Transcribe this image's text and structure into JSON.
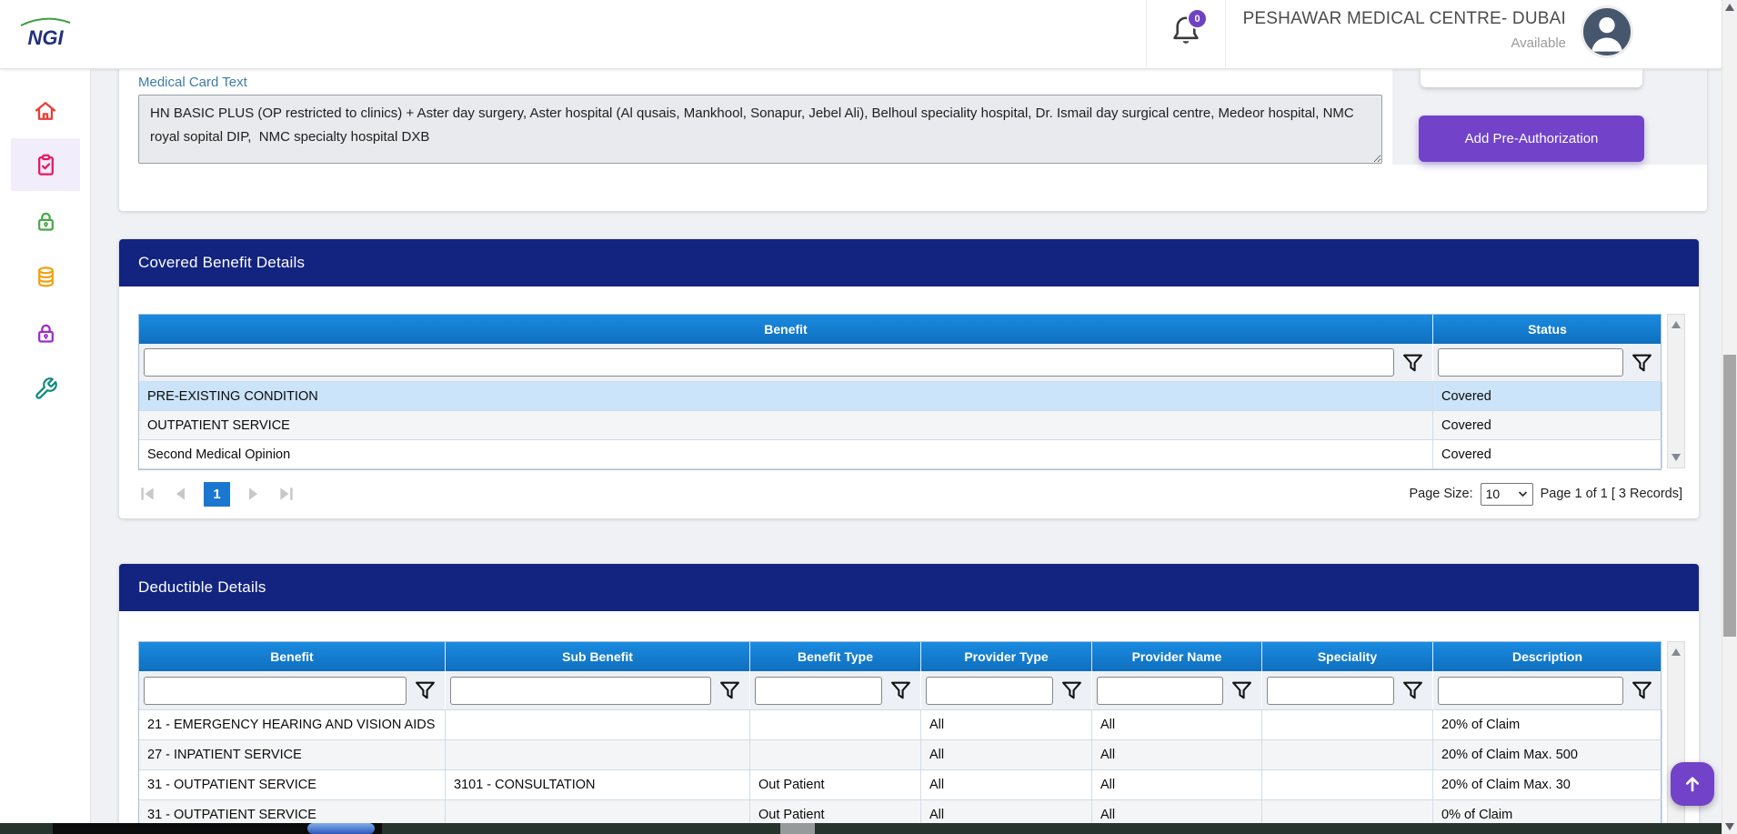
{
  "header": {
    "logo": "NGI",
    "notification_count": "0",
    "provider_name": "PESHAWAR MEDICAL CENTRE- DUBAI",
    "availability": "Available"
  },
  "sidebar": {
    "items": [
      {
        "id": "home",
        "icon": "home-icon",
        "active": false
      },
      {
        "id": "claims",
        "icon": "clipboard-check-icon",
        "active": true
      },
      {
        "id": "unlock",
        "icon": "padlock-green-icon",
        "active": false
      },
      {
        "id": "records",
        "icon": "coins-stack-icon",
        "active": false
      },
      {
        "id": "security",
        "icon": "padlock-purple-icon",
        "active": false
      },
      {
        "id": "tools",
        "icon": "wrench-icon",
        "active": false
      }
    ]
  },
  "medical_card": {
    "label": "Medical Card Text",
    "value": "HN BASIC PLUS (OP restricted to clinics) + Aster day surgery, Aster hospital (Al qusais, Mankhool, Sonapur, Jebel Ali), Belhoul speciality hospital, Dr. Ismail day surgical centre, Medeor hospital, NMC royal sopital DIP,  NMC specialty hospital DXB"
  },
  "actions": {
    "add_preauth_label": "Add Pre-Authorization"
  },
  "covered_benefits": {
    "title": "Covered Benefit Details",
    "columns": [
      "Benefit",
      "Status"
    ],
    "rows": [
      {
        "cells": [
          "PRE-EXISTING CONDITION",
          "Covered"
        ],
        "selected": true
      },
      {
        "cells": [
          "OUTPATIENT SERVICE",
          "Covered"
        ],
        "selected": false
      },
      {
        "cells": [
          "Second Medical Opinion",
          "Covered"
        ],
        "selected": false
      }
    ],
    "pagination": {
      "current_page": "1",
      "page_size_label": "Page Size:",
      "page_size": "10",
      "summary": "Page 1 of 1 [ 3 Records]"
    }
  },
  "deductibles": {
    "title": "Deductible Details",
    "columns": [
      "Benefit",
      "Sub Benefit",
      "Benefit Type",
      "Provider Type",
      "Provider Name",
      "Speciality",
      "Description"
    ],
    "rows": [
      {
        "cells": [
          "21 - EMERGENCY HEARING AND VISION AIDS",
          "",
          "",
          "All",
          "All",
          "",
          "20% of Claim"
        ],
        "selected": false
      },
      {
        "cells": [
          "27 - INPATIENT SERVICE",
          "",
          "",
          "All",
          "All",
          "",
          "20% of Claim Max. 500"
        ],
        "selected": false
      },
      {
        "cells": [
          "31 - OUTPATIENT SERVICE",
          "3101 - CONSULTATION",
          "Out Patient",
          "All",
          "All",
          "",
          "20% of Claim Max. 30"
        ],
        "selected": false
      },
      {
        "cells": [
          "31 - OUTPATIENT SERVICE",
          "",
          "Out Patient",
          "All",
          "All",
          "",
          "0% of Claim"
        ],
        "selected": false
      }
    ]
  },
  "colors": {
    "accent_purple": "#7243c9",
    "badge_purple": "#6f42c1",
    "panel_navy": "#12247f",
    "grid_header_blue": "#1180cf",
    "selected_row_blue": "#cce4f9",
    "pager_page_blue": "#1977cf",
    "label_blue": "#3c7ca6"
  }
}
